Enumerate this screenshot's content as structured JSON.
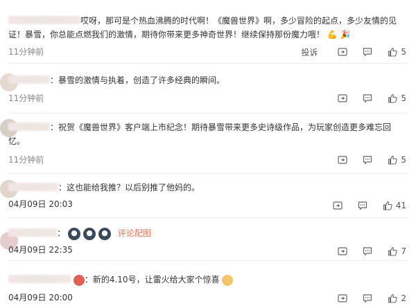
{
  "comments": [
    {
      "text": "哎呀，那可是个热血沸腾的时代啊！《魔兽世界》啊，多少冒险的起点，多少友情的见证！暴雪，你总能点燃我们的激情，期待你带来更多神奇世界！继续保持那份魔力哦！",
      "emoji": [
        "💪",
        "🎉"
      ],
      "time": "11分钟前",
      "report_label": "投诉",
      "likes": "5"
    },
    {
      "text": "暴雪的激情与执着，创造了许多经典的瞬间。",
      "time": "11分钟前",
      "likes": "5"
    },
    {
      "text": "祝贺《魔兽世界》客户端上市纪念！期待暴雪带来更多史诗级作品，为玩家创造更多难忘回忆。",
      "time": "11分钟前",
      "likes": "5"
    },
    {
      "text": "这也能给我推？以后别推了他妈的。",
      "time": "04月09日 20:03",
      "likes": "41"
    },
    {
      "pic_label": "评论配图",
      "time": "04月09日 22:35",
      "likes": "7"
    },
    {
      "text": "新的4.10号，让雷火给大家个惊喜",
      "time": "04月09日 20:00",
      "likes": "2"
    }
  ],
  "colon": "：",
  "icons": {
    "share": "share-icon",
    "comment": "comment-icon",
    "like": "thumbs-up-icon"
  },
  "colors": {
    "link": "#eb7350",
    "muted": "#888888",
    "text": "#333333"
  }
}
